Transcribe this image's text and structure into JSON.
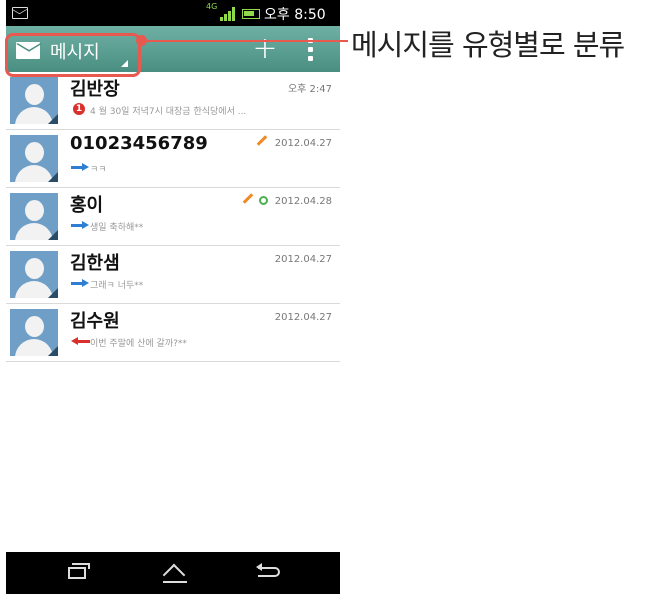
{
  "status_bar": {
    "network_label": "4G",
    "time": "오후 8:50"
  },
  "action_bar": {
    "title": "메시지",
    "add_button_label": "+"
  },
  "callout": {
    "text": "메시지를 유형별로 분류"
  },
  "colors": {
    "accent": "#5c9e92",
    "highlight": "#e85a4f",
    "avatar": "#6f9fc6",
    "outgoing_arrow": "#2e7fd4",
    "incoming_arrow": "#d9302c",
    "draft": "#f08a24",
    "scheduled": "#4caf50"
  },
  "conversations": [
    {
      "name": "김반장",
      "date": "오후 2:47",
      "preview": "4 월 30일 저녁7시 대장금 한식당에서 ...",
      "status": "unread",
      "unread_count": "1"
    },
    {
      "name": "01023456789",
      "date": "2012.04.27",
      "preview": "ㅋㅋ",
      "status": "outgoing",
      "draft": true
    },
    {
      "name": "홍이",
      "date": "2012.04.28",
      "preview": "생일 축하해**",
      "status": "outgoing",
      "draft": true,
      "scheduled": true
    },
    {
      "name": "김한샘",
      "date": "2012.04.27",
      "preview": "그래ㅋ 너두**",
      "status": "outgoing"
    },
    {
      "name": "김수원",
      "date": "2012.04.27",
      "preview": "이번 주말에 산에 갈까?**",
      "status": "incoming"
    }
  ],
  "nav_bar": {
    "icons": [
      "recent-apps-icon",
      "home-icon",
      "back-icon"
    ]
  }
}
